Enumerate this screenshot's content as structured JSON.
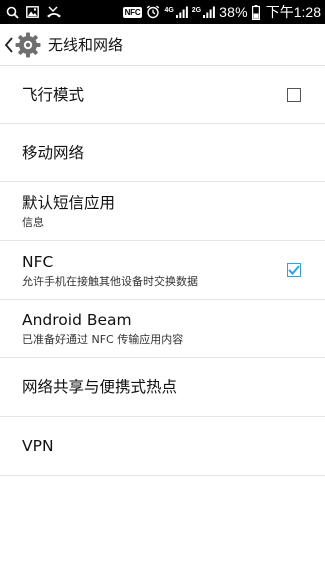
{
  "status_bar": {
    "nfc_label": "NFC",
    "net_label_1": "4G",
    "net_label_2": "2G",
    "battery_text": "38%",
    "time": "下午1:28"
  },
  "action_bar": {
    "title": "无线和网络"
  },
  "settings": {
    "items": [
      {
        "title": "飞行模式",
        "subtitle": "",
        "checkbox": false
      },
      {
        "title": "移动网络",
        "subtitle": ""
      },
      {
        "title": "默认短信应用",
        "subtitle": "信息"
      },
      {
        "title": "NFC",
        "subtitle": "允许手机在接触其他设备时交换数据",
        "checkbox": true
      },
      {
        "title": "Android Beam",
        "subtitle": "已准备好通过 NFC 传输应用内容"
      },
      {
        "title": "网络共享与便携式热点",
        "subtitle": ""
      },
      {
        "title": "VPN",
        "subtitle": ""
      }
    ]
  },
  "colors": {
    "status_bar_bg": "#000000",
    "checkbox_accent": "#2aa3e8",
    "divider": "#e6e6e6"
  },
  "icons": [
    "search-icon",
    "image-icon",
    "missed-call-icon",
    "alarm-icon",
    "signal-icon",
    "battery-icon",
    "back-icon",
    "settings-gear-icon",
    "checkmark-icon"
  ]
}
